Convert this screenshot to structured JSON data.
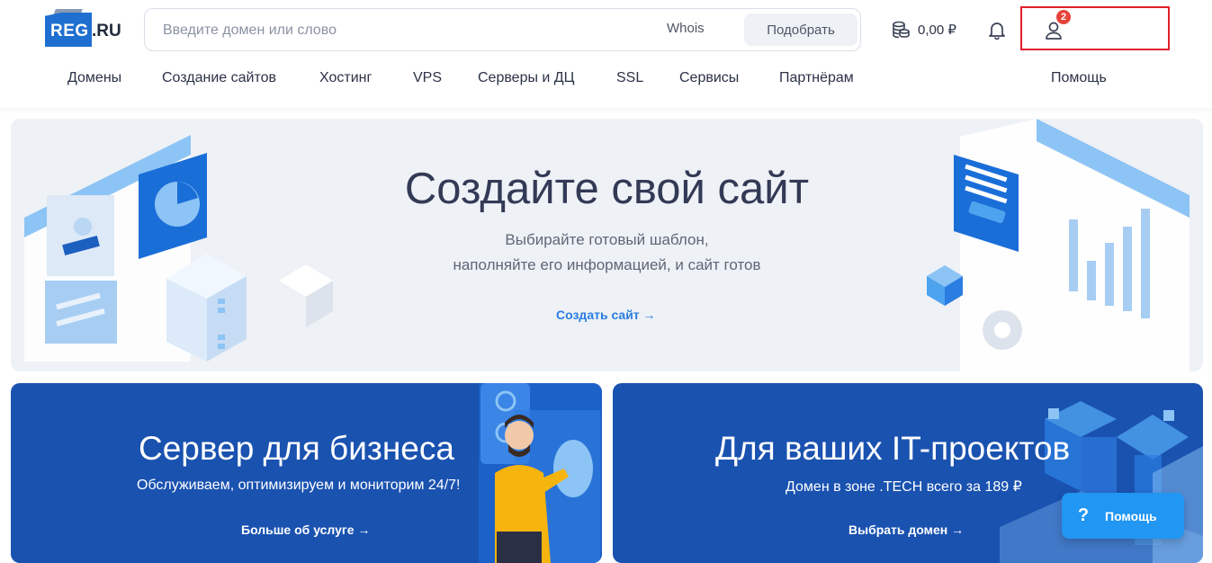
{
  "logo": {
    "part1": "REG",
    "part2": ".RU"
  },
  "search": {
    "placeholder": "Введите домен или слово",
    "whois": "Whois",
    "pick": "Подобрать"
  },
  "balance": "0,00 ₽",
  "notifications": {
    "count": "2"
  },
  "nav": {
    "items": [
      "Домены",
      "Создание сайтов",
      "Хостинг",
      "VPS",
      "Серверы и ДЦ",
      "SSL",
      "Сервисы",
      "Партнёрам"
    ],
    "help": "Помощь"
  },
  "hero": {
    "title": "Создайте свой сайт",
    "subtitle_line1": "Выбирайте готовый шаблон,",
    "subtitle_line2": "наполняйте его информацией, и сайт готов",
    "link": "Создать сайт →"
  },
  "cards": [
    {
      "title": "Сервер для бизнеса",
      "subtitle": "Обслуживаем, оптимизируем и мониторим 24/7!",
      "link": "Больше об услуге →"
    },
    {
      "title": "Для ваших IT-проектов",
      "subtitle": "Домен в зоне .TECH всего за 189 ₽",
      "link": "Выбрать домен →"
    }
  ],
  "help_button": {
    "icon": "?",
    "label": "Помощь"
  },
  "colors": {
    "accent": "#2a7de1",
    "card_bg": "#1a52b0",
    "badge": "#e5433a",
    "highlight_border": "#e11f2c"
  }
}
